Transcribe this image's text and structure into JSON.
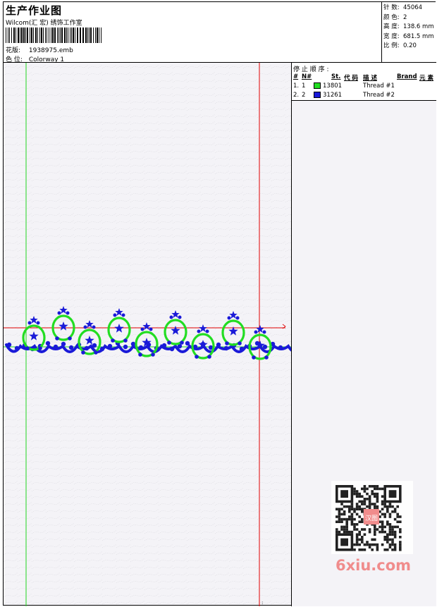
{
  "header": {
    "title": "生产作业图",
    "company": "Wilcom(汇 宏) 绣饰工作室",
    "file_label": "花版:",
    "file_value": "1938975.emb",
    "colorway_label": "色 位:",
    "colorway_value": "Colorway 1"
  },
  "stats": {
    "stitches_label": "针 数:",
    "stitches_value": "45064",
    "colors_label": "颜 色:",
    "colors_value": "2",
    "height_label": "高 度:",
    "height_value": "138.6 mm",
    "width_label": "宽 度:",
    "width_value": "681.5 mm",
    "scale_label": "比 例:",
    "scale_value": "0.20"
  },
  "sequence": {
    "title": "停 止 顺 序 :",
    "columns": {
      "hash": "#",
      "no": "N#",
      "st": "St.",
      "code": "代 码",
      "desc": "描 述",
      "brand": "Brand",
      "elem": "元 素"
    },
    "rows": [
      {
        "index": "1.",
        "no": "1",
        "code": "13801",
        "desc": "Thread #1",
        "color": "#22dd22"
      },
      {
        "index": "2.",
        "no": "2",
        "code": "31261",
        "desc": "Thread #2",
        "color": "#1a1ad8"
      }
    ]
  },
  "colors": {
    "green_guide": "#1fd41f",
    "red_guide": "#e00000",
    "motif_blue": "#1a1ad8",
    "motif_green": "#22dd22"
  },
  "watermark": {
    "text": "6xiu.com",
    "stamp": "汉图"
  }
}
